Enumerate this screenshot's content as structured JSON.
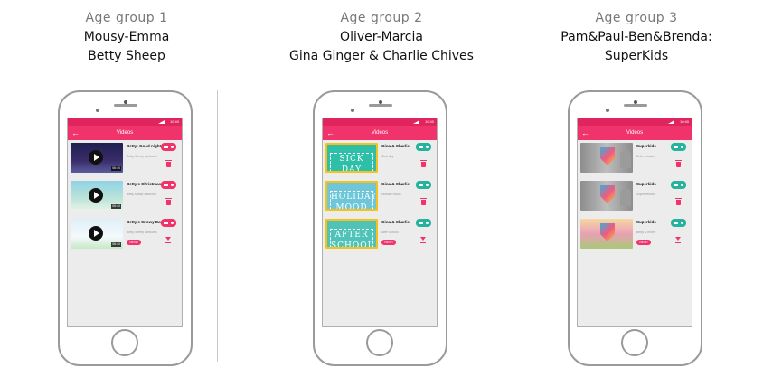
{
  "colors": {
    "accent": "#f0336b",
    "status_bar": "#e0245e",
    "teal": "#25b39e"
  },
  "columns": [
    {
      "group_label": "Age group 1",
      "line1": "Mousy-Emma",
      "line2": "Betty Sheep",
      "status_time": "10:40",
      "app_title": "Videos",
      "items": [
        {
          "title": "Betty: Good night",
          "subtitle": "Betty Sheep cartoons",
          "duration": "06:40",
          "badge": ""
        },
        {
          "title": "Betty's Christmas",
          "subtitle": "Betty sheep cartoons",
          "duration": "06:40",
          "badge": ""
        },
        {
          "title": "Betty's Snowy Day",
          "subtitle": "Betty Sheep cartoons",
          "duration": "06:40",
          "badge": "NEW!"
        }
      ]
    },
    {
      "group_label": "Age group 2",
      "line1": "Oliver-Marcia",
      "line2": "Gina Ginger & Charlie Chives",
      "status_time": "10:40",
      "app_title": "Videos",
      "items": [
        {
          "title": "Gina & Charlie",
          "subtitle": "Sick day",
          "thumb_text": "SICK DAY",
          "badge": ""
        },
        {
          "title": "Gina & Charlie",
          "subtitle": "Holiday mood",
          "thumb_text": "HOLIDAY MOOD",
          "badge": ""
        },
        {
          "title": "Gina & Charlie",
          "subtitle": "After school",
          "thumb_text": "AFTER SCHOOL",
          "badge": "NEW!"
        }
      ]
    },
    {
      "group_label": "Age group 3",
      "line1": "Pam&Paul-Ben&Brenda:",
      "line2": "SuperKids",
      "status_time": "10:40",
      "app_title": "Videos",
      "items": [
        {
          "title": "Superkids",
          "subtitle": "Enter mission",
          "badge": ""
        },
        {
          "title": "Superkids",
          "subtitle": "Superheroes",
          "badge": ""
        },
        {
          "title": "Superkids",
          "subtitle": "Betty & more",
          "badge": "NEW!"
        }
      ]
    }
  ]
}
